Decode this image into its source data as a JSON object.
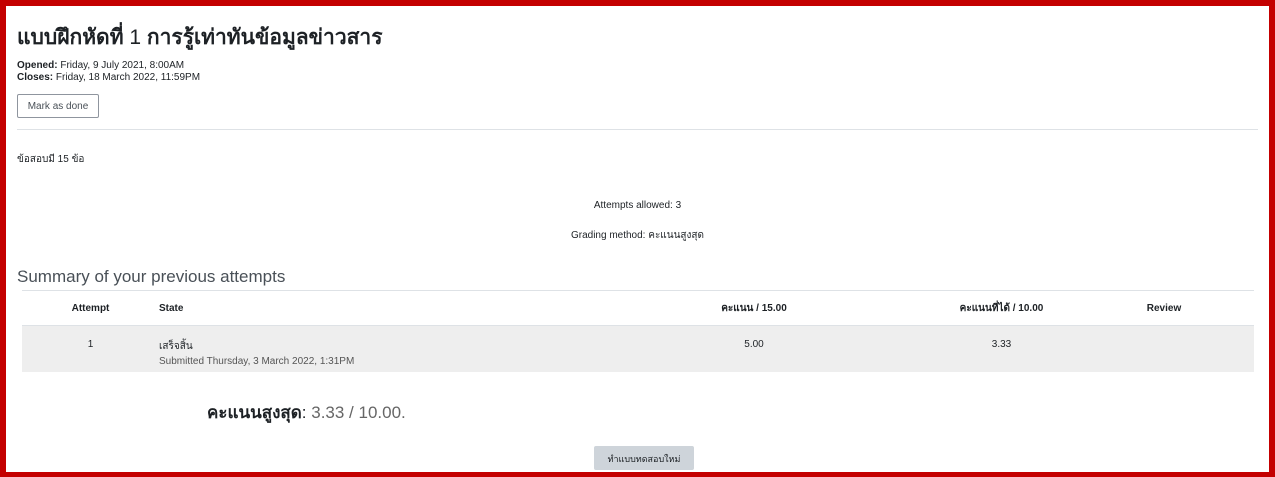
{
  "activity": {
    "title_prefix": "แบบฝึกหัดที่",
    "title_number": "1",
    "title_suffix": "การรู้เท่าทันข้อมูลข่าวสาร",
    "opened_label": "Opened:",
    "opened_value": "Friday, 9 July 2021, 8:00AM",
    "closes_label": "Closes:",
    "closes_value": "Friday, 18 March 2022, 11:59PM",
    "mark_done_label": "Mark as done"
  },
  "intro": {
    "text": "ข้อสอบมี 15 ข้อ"
  },
  "quiz_info": {
    "attempts_allowed": "Attempts allowed: 3",
    "grading_label": "Grading method:",
    "grading_value": "คะแนนสูงสุด"
  },
  "summary": {
    "title": "Summary of your previous attempts",
    "columns": [
      "Attempt",
      "State",
      "คะแนน / 15.00",
      "คะแนนที่ได้ / 10.00",
      "Review"
    ],
    "rows": [
      {
        "attempt": "1",
        "state": "เสร็จสิ้น",
        "submitted": "Submitted Thursday, 3 March 2022, 1:31PM",
        "marks": "5.00",
        "grade": "3.33",
        "review": ""
      }
    ]
  },
  "final_grade": {
    "label": "คะแนนสูงสุด",
    "value": "3.33 / 10.00."
  },
  "actions": {
    "reattempt_label": "ทำแบบทดสอบใหม่"
  },
  "colors": {
    "frame_border": "#c40000",
    "row_bg": "#eeeeee",
    "button_bg": "#ced4da"
  }
}
